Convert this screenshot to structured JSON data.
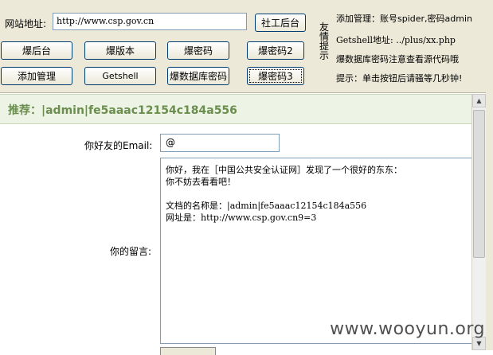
{
  "toolbar": {
    "url_label": "网站地址:",
    "url_value": "http://www.csp.gov.cn",
    "social_button": "社工后台",
    "row1": [
      "爆后台",
      "爆版本",
      "爆密码",
      "爆密码2"
    ],
    "row2": [
      "添加管理",
      "Getshell",
      "爆数据库密码",
      "爆密码3"
    ],
    "vertical_label": [
      "友",
      "情",
      "提",
      "示"
    ],
    "tips": [
      "添加管理：账号spider,密码admin",
      "Getshell地址: ../plus/xx.php",
      "爆数据库密码注意查看源代码哦",
      "提示：单击按钮后请骚等几秒钟!"
    ]
  },
  "recommend": {
    "text": "推荐：|admin|fe5aaac12154c184a556"
  },
  "form": {
    "email_label": "你好友的Email:",
    "email_value": "@",
    "message_label": "你的留言:",
    "message_lines": [
      "你好，我在［中国公共安全认证网］发现了一个很好的东东：",
      "你不妨去看看吧！",
      "",
      "文档的名称是：|admin|fe5aaac12154c184a556",
      "网址是：http://www.csp.gov.cn9=3"
    ]
  },
  "scrollbar": {
    "up_icon": "▲",
    "down_icon": "▼"
  },
  "watermark": "www.wooyun.org",
  "colors": {
    "panel_bg": "#ece9d8",
    "recommend_bg": "#edf4e6",
    "recommend_text": "#6b8e4e",
    "input_border": "#7f9db9"
  }
}
